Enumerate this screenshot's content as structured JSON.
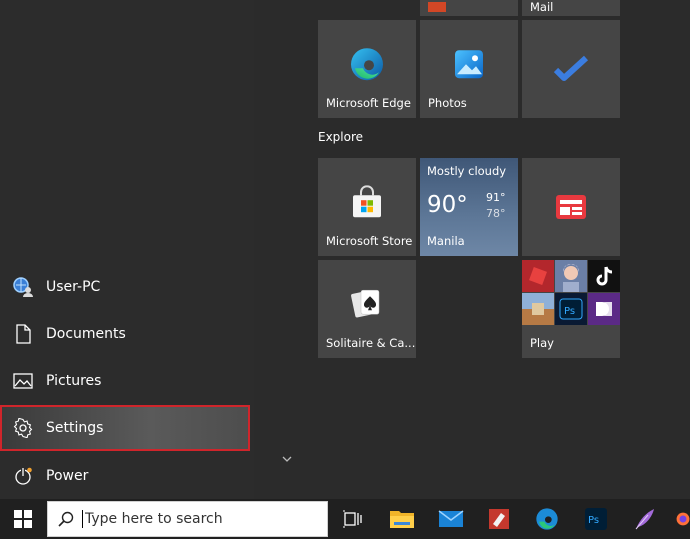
{
  "left_menu": {
    "items": [
      {
        "label": "User-PC",
        "icon": "user-icon"
      },
      {
        "label": "Documents",
        "icon": "document-icon"
      },
      {
        "label": "Pictures",
        "icon": "pictures-icon"
      },
      {
        "label": "Settings",
        "icon": "gear-icon"
      },
      {
        "label": "Power",
        "icon": "power-icon"
      }
    ]
  },
  "tiles": {
    "top_row_partial": {
      "label": "Mail"
    },
    "edge": {
      "label": "Microsoft Edge"
    },
    "photos": {
      "label": "Photos"
    },
    "todo": {
      "label": ""
    },
    "explore_title": "Explore",
    "store": {
      "label": "Microsoft Store"
    },
    "weather": {
      "condition": "Mostly cloudy",
      "temp": "90°",
      "high": "91°",
      "low": "78°",
      "city": "Manila"
    },
    "news": {
      "label": ""
    },
    "solitaire": {
      "label": "Solitaire & Ca..."
    },
    "play": {
      "label": "Play"
    }
  },
  "taskbar": {
    "search_placeholder": "Type here to search",
    "icons": [
      "start-icon",
      "task-view-icon",
      "file-explorer-icon",
      "mail-icon",
      "office-icon",
      "edge-icon",
      "photoshop-icon",
      "feather-icon",
      "firefox-icon"
    ]
  },
  "colors": {
    "highlight_border": "#d0252b",
    "tile_bg": "#454545",
    "panel_bg": "#2c2c2c",
    "taskbar_bg": "#202020"
  }
}
